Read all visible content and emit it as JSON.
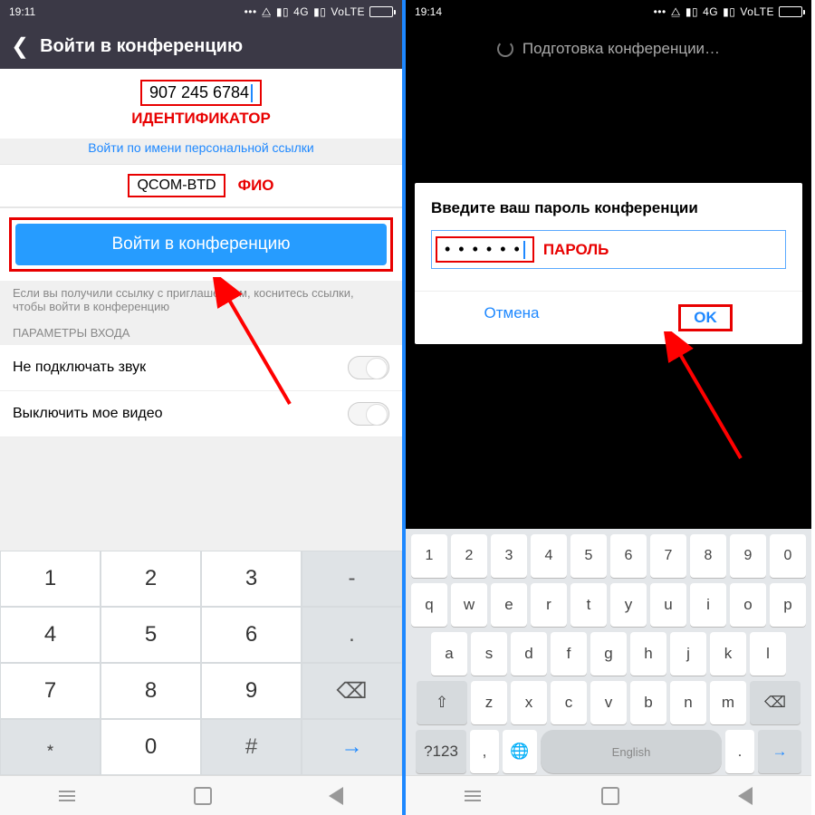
{
  "left": {
    "status": {
      "time": "19:11",
      "net": "4G",
      "volte": "VoLTE"
    },
    "title": "Войти в конференцию",
    "meeting_id": "907 245 6784",
    "label_id": "ИДЕНТИФИКАТОР",
    "personal_link": "Войти по имени персональной ссылки",
    "name_value": "QCOM-BTD",
    "label_name": "ФИО",
    "join_button": "Войти в конференцию",
    "hint": "Если вы получили ссылку с приглашением, коснитесь ссылки, чтобы войти в конференцию",
    "section": "ПАРАМЕТРЫ ВХОДА",
    "opt_audio": "Не подключать звук",
    "opt_video": "Выключить мое видео",
    "keys": [
      "1",
      "2",
      "3",
      "-",
      "4",
      "5",
      "6",
      ".",
      "7",
      "8",
      "9",
      "⌫",
      "﹡",
      "0",
      "#",
      "→"
    ]
  },
  "right": {
    "status": {
      "time": "19:14",
      "net": "4G",
      "volte": "VoLTE"
    },
    "loading": "Подготовка конференции…",
    "dialog_title": "Введите ваш пароль конференции",
    "password_mask": "• • • • • •",
    "label_password": "ПАРОЛЬ",
    "cancel": "Отмена",
    "ok": "OK",
    "row_num": [
      "1",
      "2",
      "3",
      "4",
      "5",
      "6",
      "7",
      "8",
      "9",
      "0"
    ],
    "row1": [
      "q",
      "w",
      "e",
      "r",
      "t",
      "y",
      "u",
      "i",
      "o",
      "p"
    ],
    "row2": [
      "a",
      "s",
      "d",
      "f",
      "g",
      "h",
      "j",
      "k",
      "l"
    ],
    "row3": [
      "⇧",
      "z",
      "x",
      "c",
      "v",
      "b",
      "n",
      "m",
      "⌫"
    ],
    "row4": {
      "sym": "?123",
      "comma": ",",
      "globe": "🌐",
      "space": "English",
      "dot": ".",
      "enter": "→"
    }
  }
}
